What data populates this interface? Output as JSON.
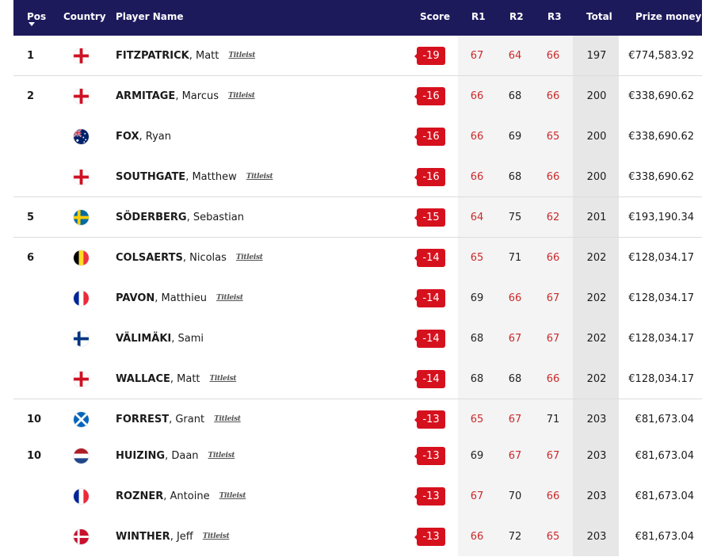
{
  "header": {
    "pos": "Pos",
    "country": "Country",
    "player": "Player Name",
    "score": "Score",
    "r1": "R1",
    "r2": "R2",
    "r3": "R3",
    "total": "Total",
    "prize": "Prize money"
  },
  "colors": {
    "header_bg": "#1d1a5c",
    "score_badge": "#d6111e",
    "over_par_text": "#cc2a2a"
  },
  "rows": [
    {
      "pos": "1",
      "country": "england-flag",
      "last": "FITZPATRICK",
      "first": ", Matt",
      "brand": "Titleist",
      "score": "-19",
      "r1": "67",
      "r2": "64",
      "r3": "66",
      "total": "197",
      "prize": "€774,583.92"
    },
    {
      "pos": "2",
      "country": "england-flag",
      "last": "ARMITAGE",
      "first": ", Marcus",
      "brand": "Titleist",
      "score": "-16",
      "r1": "66",
      "r2": "68",
      "r3": "66",
      "total": "200",
      "prize": "€338,690.62"
    },
    {
      "pos": "",
      "country": "australia-flag",
      "last": "FOX",
      "first": ", Ryan",
      "brand": "",
      "score": "-16",
      "r1": "66",
      "r2": "69",
      "r3": "65",
      "total": "200",
      "prize": "€338,690.62"
    },
    {
      "pos": "",
      "country": "england-flag",
      "last": "SOUTHGATE",
      "first": ", Matthew",
      "brand": "Titleist",
      "score": "-16",
      "r1": "66",
      "r2": "68",
      "r3": "66",
      "total": "200",
      "prize": "€338,690.62"
    },
    {
      "pos": "5",
      "country": "sweden-flag",
      "last": "SÖDERBERG",
      "first": ", Sebastian",
      "brand": "",
      "score": "-15",
      "r1": "64",
      "r2": "75",
      "r3": "62",
      "total": "201",
      "prize": "€193,190.34"
    },
    {
      "pos": "6",
      "country": "belgium-flag",
      "last": "COLSAERTS",
      "first": ", Nicolas",
      "brand": "Titleist",
      "score": "-14",
      "r1": "65",
      "r2": "71",
      "r3": "66",
      "total": "202",
      "prize": "€128,034.17"
    },
    {
      "pos": "",
      "country": "france-flag",
      "last": "PAVON",
      "first": ", Matthieu",
      "brand": "Titleist",
      "score": "-14",
      "r1": "69",
      "r2": "66",
      "r3": "67",
      "total": "202",
      "prize": "€128,034.17"
    },
    {
      "pos": "",
      "country": "finland-flag",
      "last": "VÄLIMÄKI",
      "first": ", Sami",
      "brand": "",
      "score": "-14",
      "r1": "68",
      "r2": "67",
      "r3": "67",
      "total": "202",
      "prize": "€128,034.17"
    },
    {
      "pos": "",
      "country": "england-flag",
      "last": "WALLACE",
      "first": ", Matt",
      "brand": "Titleist",
      "score": "-14",
      "r1": "68",
      "r2": "68",
      "r3": "66",
      "total": "202",
      "prize": "€128,034.17"
    },
    {
      "pos": "10",
      "country": "scotland-flag",
      "last": "FORREST",
      "first": ", Grant",
      "brand": "Titleist",
      "score": "-13",
      "r1": "65",
      "r2": "67",
      "r3": "71",
      "total": "203",
      "prize": "€81,673.04"
    },
    {
      "pos": "10",
      "country": "netherlands-flag",
      "last": "HUIZING",
      "first": ", Daan",
      "brand": "Titleist",
      "score": "-13",
      "r1": "69",
      "r2": "67",
      "r3": "67",
      "total": "203",
      "prize": "€81,673.04"
    },
    {
      "pos": "",
      "country": "france-flag",
      "last": "ROZNER",
      "first": ", Antoine",
      "brand": "Titleist",
      "score": "-13",
      "r1": "67",
      "r2": "70",
      "r3": "66",
      "total": "203",
      "prize": "€81,673.04"
    },
    {
      "pos": "",
      "country": "denmark-flag",
      "last": "WINTHER",
      "first": ", Jeff",
      "brand": "Titleist",
      "score": "-13",
      "r1": "66",
      "r2": "72",
      "r3": "65",
      "total": "203",
      "prize": "€81,673.04"
    }
  ]
}
